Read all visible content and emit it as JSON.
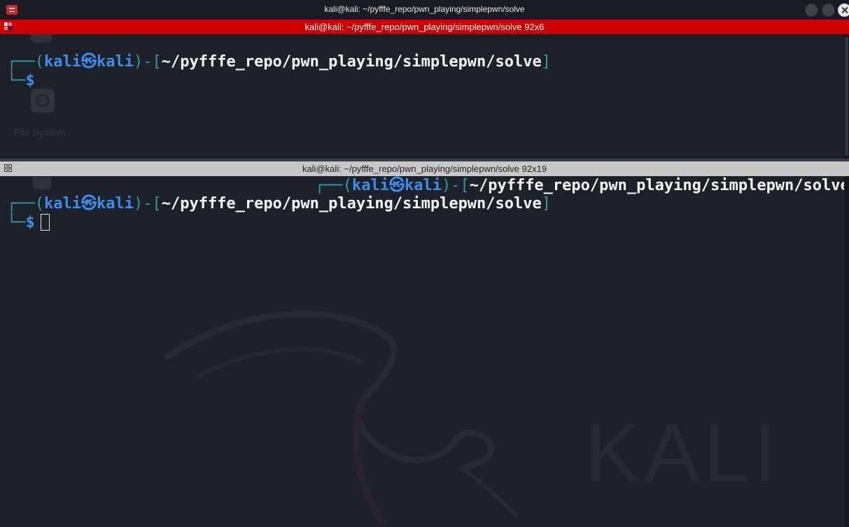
{
  "window": {
    "title": "kali@kali: ~/pyfffe_repo/pwn_playing/simplepwn/solve",
    "icon": "terminal-app-icon",
    "controls": [
      "minimize-icon",
      "maximize-icon",
      "close-icon"
    ]
  },
  "desktop": {
    "icon_label": "File System",
    "wallpaper_text": "KALI"
  },
  "colors": {
    "active_header": "#cc0000",
    "inactive_header": "#c8c8c8",
    "prompt_frame": "#2f9e9e",
    "prompt_user": "#3b8eea",
    "prompt_path": "#f5f5f5",
    "background": "#1d212a"
  },
  "panes": {
    "top": {
      "title": "kali@kali: ~/pyfffe_repo/pwn_playing/simplepwn/solve 92x6",
      "prompt": {
        "frame_top": "┌──(",
        "user": "kali",
        "skull": "㉿",
        "host": "kali",
        "mid": ")-[",
        "path": "~/pyfffe_repo/pwn_playing/simplepwn/solve",
        "close": "]",
        "frame_bottom": "└─",
        "dollar": "$"
      }
    },
    "bottom": {
      "title": "kali@kali: ~/pyfffe_repo/pwn_playing/simplepwn/solve 92x19",
      "wrapped": {
        "frame_top": "┌──(",
        "user": "kali",
        "skull": "㉿",
        "host": "kali",
        "mid": ")-[",
        "path": "~/pyfffe_repo/pwn_playing/simplepwn/solve"
      },
      "prompt": {
        "frame_top": "┌──(",
        "user": "kali",
        "skull": "㉿",
        "host": "kali",
        "mid": ")-[",
        "path": "~/pyfffe_repo/pwn_playing/simplepwn/solve",
        "close": "]",
        "frame_bottom": "└─",
        "dollar": "$"
      }
    }
  }
}
